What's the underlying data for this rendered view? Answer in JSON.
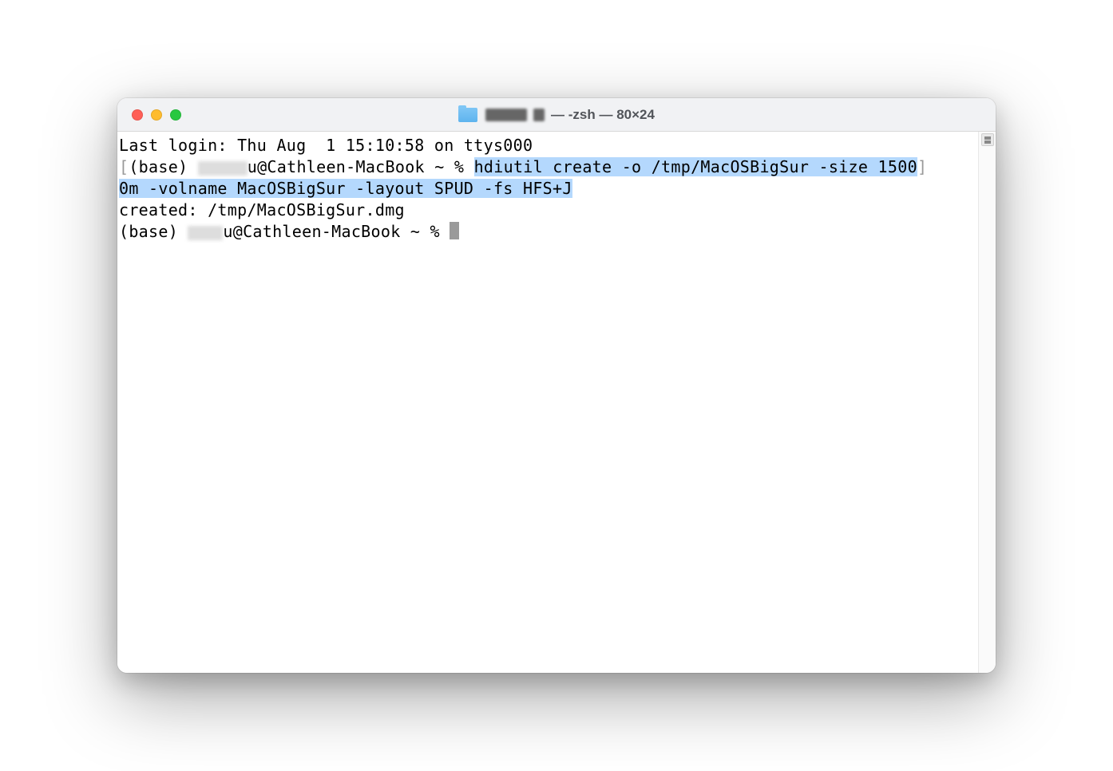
{
  "window": {
    "title_suffix": " — -zsh — 80×24",
    "folder_label_redacted": "█████"
  },
  "terminal": {
    "last_login": "Last login: Thu Aug  1 15:10:58 on ttys000",
    "prompt1_prefix": "(base) ",
    "prompt1_user_redacted": "█████",
    "prompt1_rest": "u@Cathleen-MacBook ~ % ",
    "command_part1": "hdiutil create -o /tmp/MacOSBigSur -size 1500",
    "command_part2": "0m -volname MacOSBigSur -layout SPUD -fs HFS+J",
    "output": "created: /tmp/MacOSBigSur.dmg",
    "prompt2_prefix": "(base) ",
    "prompt2_user_redacted": "████",
    "prompt2_rest": "u@Cathleen-MacBook ~ % "
  }
}
